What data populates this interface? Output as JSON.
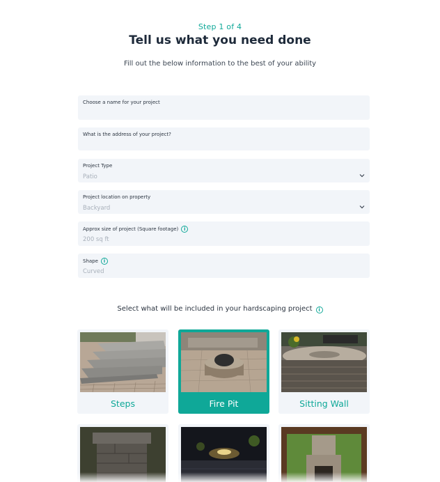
{
  "header": {
    "step": "Step 1 of 4",
    "title": "Tell us what you need done",
    "subtitle": "Fill out the below information to the best of your ability"
  },
  "form": {
    "name_label": "Choose a name for your project",
    "address_label": "What is the address of your project?",
    "type_label": "Project Type",
    "type_value": "Patio",
    "location_label": "Project location on property",
    "location_value": "Backyard",
    "size_label": "Approx size of project (Square footage)",
    "size_placeholder": "200 sq ft",
    "shape_label": "Shape",
    "shape_placeholder": "Curved",
    "info_glyph": "i"
  },
  "features": {
    "title": "Select what will be included in your hardscaping project",
    "cards": [
      {
        "label": "Steps",
        "selected": false
      },
      {
        "label": "Fire Pit",
        "selected": true
      },
      {
        "label": "Sitting Wall",
        "selected": false
      },
      {
        "label": "",
        "selected": false
      },
      {
        "label": "",
        "selected": false
      },
      {
        "label": "",
        "selected": false
      }
    ]
  },
  "colors": {
    "accent": "#0fa898",
    "field_bg": "#f2f5f9",
    "title": "#1e2a3a"
  },
  "icons": {
    "info": "info-icon",
    "select_arrow": "chevron-down-icon"
  }
}
